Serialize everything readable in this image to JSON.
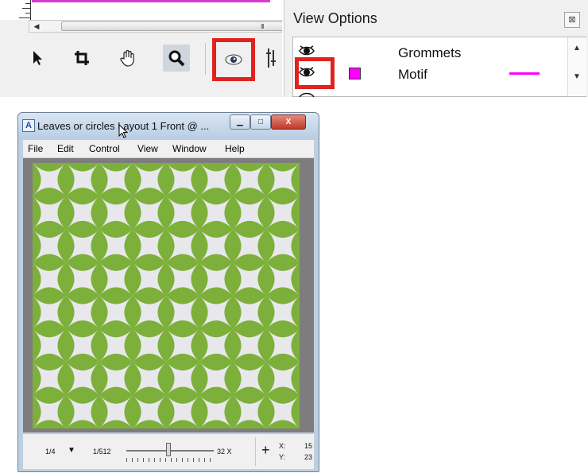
{
  "toolbar": {
    "scroll_grip": "III",
    "tools": [
      {
        "icon": "arrow-pointer-icon",
        "name": "select"
      },
      {
        "icon": "crop-icon",
        "name": "crop"
      },
      {
        "icon": "hand-icon",
        "name": "pan"
      },
      {
        "icon": "magnifier-icon",
        "name": "zoom",
        "selected": true
      },
      {
        "icon": "eye-icon",
        "name": "view-options",
        "highlighted": true
      }
    ],
    "highlight_color": "#e0231f"
  },
  "view_options": {
    "title": "View Options",
    "close_symbol": "⊠",
    "rows": [
      {
        "label": "Grommets",
        "visible": true,
        "swatch_color": null,
        "line_color": null
      },
      {
        "label": "Motif",
        "visible": true,
        "swatch_color": "#ff00ff",
        "line_color": "#ff00ff"
      }
    ]
  },
  "window": {
    "app_icon_text": "A",
    "title": "Leaves or circles Layout 1 Front @ ...",
    "buttons": {
      "minimize": "▁",
      "maximize": "□",
      "close": "X"
    },
    "menu": [
      "File",
      "Edit",
      "Control",
      "View",
      "Window",
      "Help"
    ],
    "pattern": {
      "leaf_color": "#7db03a",
      "background_color": "#e8e8ec",
      "cells": 8
    }
  },
  "status": {
    "page": "1/4",
    "page_dropdown": "▼",
    "zoom_min": "1/512",
    "zoom_max": "32 X",
    "zoom_position": 0.48,
    "x_label": "X:",
    "y_label": "Y:",
    "x_value": "15",
    "y_value": "23"
  }
}
